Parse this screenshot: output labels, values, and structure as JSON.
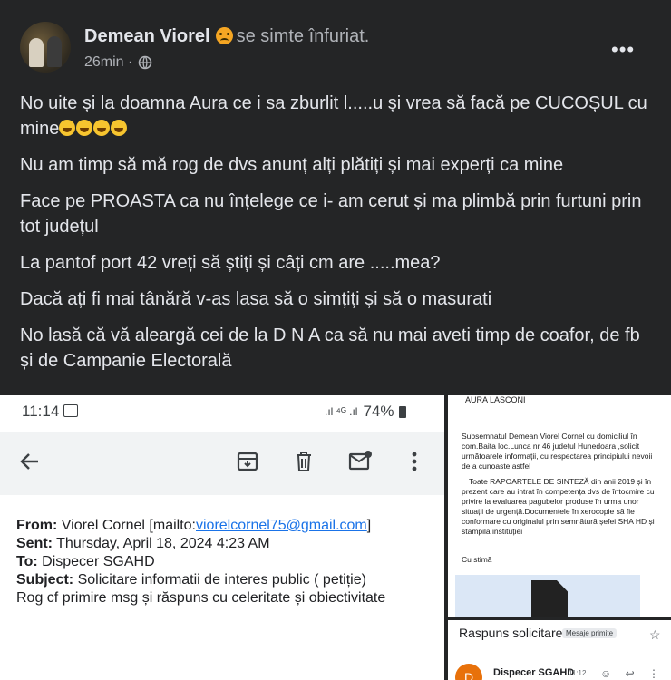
{
  "post": {
    "author": "Demean Viorel",
    "feeling": "se simte înfuriat.",
    "time": "26min ·",
    "paragraphs": [
      "No uite și la doamna Aura ce i sa zburlit l.....u și vrea să facă pe CUCOȘUL cu mine",
      "Nu am timp să mă rog de dvs anunț alți plătiți și mai experți ca mine",
      "Face pe PROASTA ca nu înțelege ce i- am cerut și ma plimbă prin furtuni prin tot județul",
      "La pantof port 42 vreți să știți și câți cm are .....mea?",
      "Dacă ați fi mai tânără v-as lasa să o simțiți și să o masurati",
      "No lasă că vă aleargă cei de la D N A  ca să nu mai aveti timp de coafor, de fb și de Campanie Electorală"
    ]
  },
  "phone": {
    "time": "11:14",
    "battery": "74%",
    "email": {
      "from_label": "From:",
      "from_name": "Viorel Cornel [mailto:",
      "from_email": "viorelcornel75@gmail.com",
      "from_close": "]",
      "sent_label": "Sent:",
      "sent_value": "Thursday, April 18, 2024 4:23 AM",
      "to_label": "To:",
      "to_value": "Dispecer SGAHD",
      "subject_label": "Subject:",
      "subject_value": "Solicitare informatii de interes public ( petiție)",
      "body": "Rog cf primire msg și răspuns cu celeritate și obiectivitate"
    }
  },
  "document": {
    "recipient": "AURA LASCONI",
    "paragraph1": "Subsemnatul Demean Viorel Cornel cu domiciliul în com.Baita loc.Lunca nr 46 județul Hunedoara ,solicit următoarele informații, cu respectarea principiului nevoii de a cunoaste,astfel",
    "paragraph2": "Toate RAPOARTELE DE SINTEZĂ din anii 2019 și în prezent care au intrat în competența dvs de întocmire cu privire la evaluarea pagubelor produse în urma unor situații de urgență.Documentele în xerocopie să fie conformare cu originalul prin semnătură șefei SHA HD și stampila instituției",
    "closing": "Cu stimă"
  },
  "reply": {
    "subject": "Raspuns solicitare",
    "tag": "Mesaje primite",
    "avatar": "D",
    "sender": "Dispecer SGAHD",
    "time": "11:12"
  }
}
